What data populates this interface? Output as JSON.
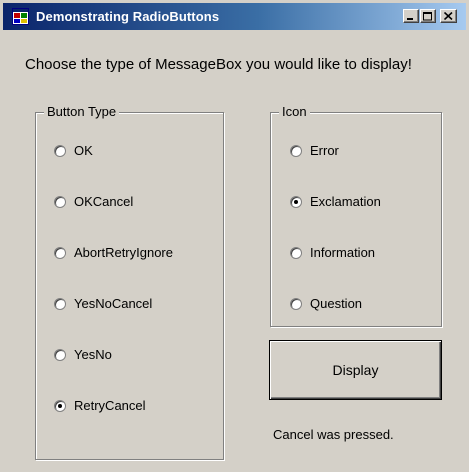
{
  "window": {
    "title": "Demonstrating RadioButtons"
  },
  "prompt": "Choose the type of MessageBox you would like to display!",
  "button_type_group": {
    "legend": "Button Type",
    "options": [
      {
        "label": "OK",
        "checked": false
      },
      {
        "label": "OKCancel",
        "checked": false
      },
      {
        "label": "AbortRetryIgnore",
        "checked": false
      },
      {
        "label": "YesNoCancel",
        "checked": false
      },
      {
        "label": "YesNo",
        "checked": false
      },
      {
        "label": "RetryCancel",
        "checked": true
      }
    ]
  },
  "icon_group": {
    "legend": "Icon",
    "options": [
      {
        "label": "Error",
        "checked": false
      },
      {
        "label": "Exclamation",
        "checked": true
      },
      {
        "label": "Information",
        "checked": false
      },
      {
        "label": "Question",
        "checked": false
      }
    ]
  },
  "display_button": "Display",
  "status": "Cancel was pressed.",
  "colors": {
    "titlebar_start": "#0a246a",
    "titlebar_end": "#a6caf0",
    "window_bg": "#d4d0c8"
  }
}
